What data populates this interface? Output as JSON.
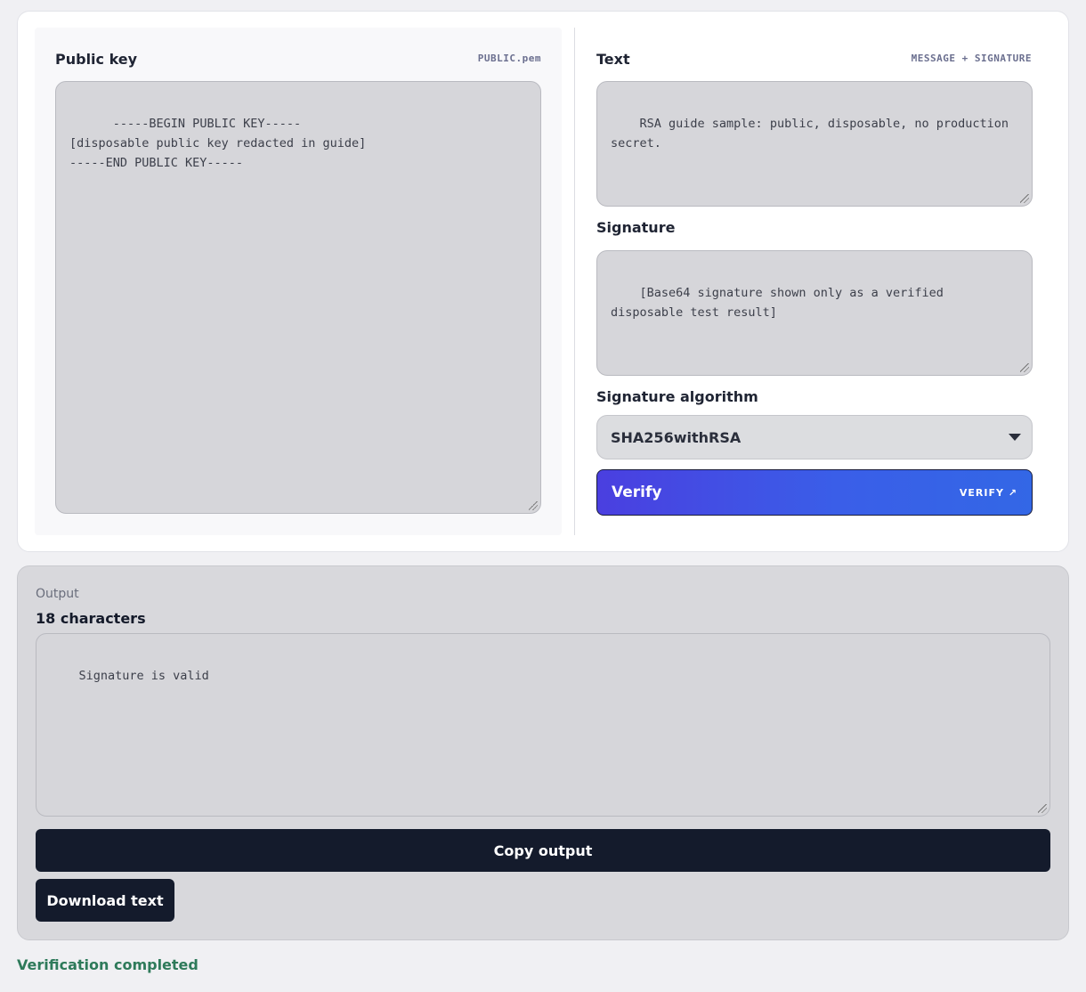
{
  "public_key": {
    "label": "Public key",
    "tag": "PUBLIC.pem",
    "value": "-----BEGIN PUBLIC KEY-----\n[disposable public key redacted in guide]\n-----END PUBLIC KEY-----"
  },
  "text": {
    "label": "Text",
    "tag": "MESSAGE + SIGNATURE",
    "value": "RSA guide sample: public, disposable, no production secret."
  },
  "signature": {
    "label": "Signature",
    "value": "[Base64 signature shown only as a verified disposable test result]"
  },
  "algorithm": {
    "label": "Signature algorithm",
    "selected": "SHA256withRSA"
  },
  "verify_button": {
    "label": "Verify",
    "tag": "VERIFY ↗"
  },
  "output": {
    "caption": "Output",
    "count": "18 characters",
    "value": "Signature is valid",
    "copy_label": "Copy output",
    "download_label": "Download text"
  },
  "status": "Verification completed",
  "colors": {
    "accent_start": "#4a3fe0",
    "accent_end": "#3367e6",
    "dark_button": "#141b2c",
    "success": "#2e7a5a"
  }
}
